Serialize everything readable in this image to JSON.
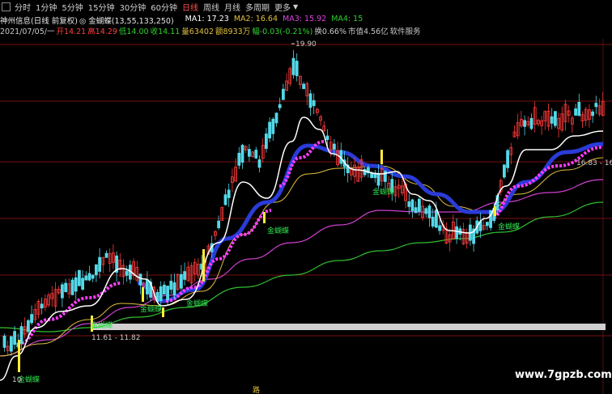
{
  "toolbar": {
    "items": [
      "分时",
      "1分钟",
      "5分钟",
      "15分钟",
      "30分钟",
      "60分钟",
      "日线",
      "周线",
      "月线",
      "多周期",
      "更多"
    ]
  },
  "info_row1": {
    "stock": "神州信息(日线 前复权)",
    "indicator": "◎ 金蝴蝶(13,55,133,250)",
    "ma1": "MA1: 17.23",
    "ma2": "MA2: 16.64",
    "ma3": "MA3: 15.92",
    "ma4": "MA4: 15"
  },
  "info_row2": {
    "date": "2021/07/05/一",
    "open": "开14.21",
    "high": "高14.29",
    "low": "低14.00",
    "close": "收14.11",
    "volume": "量63402",
    "amount": "额8933万",
    "change": "幅-0.03(-0.21%)",
    "turnover": "换0.66%",
    "float_cap": "市值4.56亿",
    "service": "软件服务"
  },
  "labels": {
    "peak": "19.90",
    "range_left": "11.61 - 11.82",
    "range_right": "16.83 - 16",
    "bottom_low": "10",
    "watermark": "www.7gpzb.com",
    "bottom_tag": "路"
  },
  "signal_label": "金蝴蝶",
  "colors": {
    "up": "#ff3b3b",
    "down": "#54d8e8",
    "ma_white": "#ffffff",
    "ma_yellow": "#e0c040",
    "ma_magenta": "#d040d0",
    "ma_green": "#30c030",
    "ribbon_blue": "#2a3bd8",
    "ribbon_pink": "#ff3cff",
    "signal_yellow": "#ffee33",
    "support_band": "#cfcfcf",
    "gridline": "#7a1010"
  }
}
